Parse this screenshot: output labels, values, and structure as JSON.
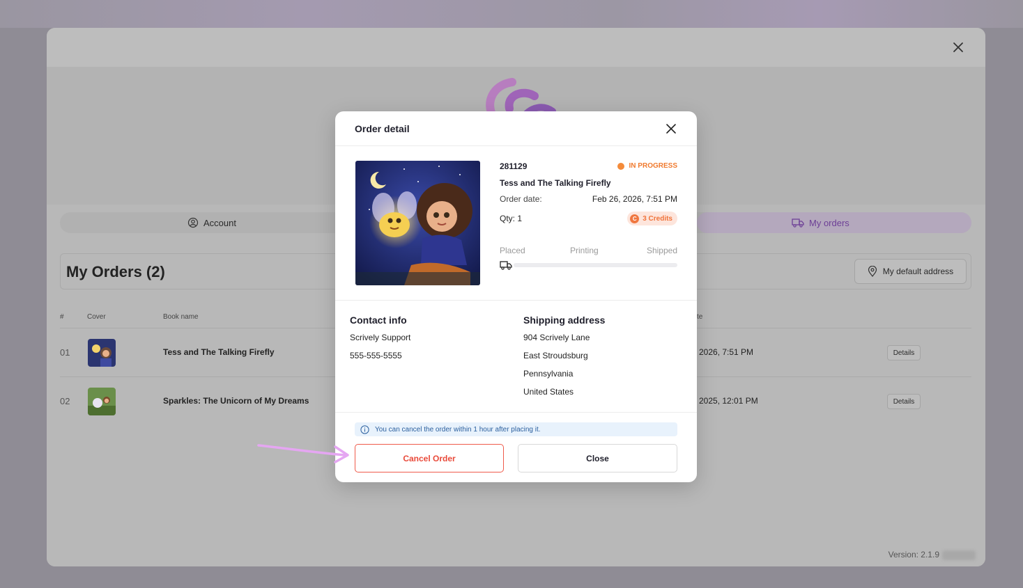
{
  "main": {
    "tabs": [
      {
        "label": "Account",
        "icon": "user-circle-icon"
      },
      {
        "label": "My orders",
        "icon": "truck-icon",
        "active": true
      }
    ],
    "orders_title": "My Orders (2)",
    "default_address_label": "My default address",
    "table": {
      "columns": [
        "#",
        "Cover",
        "Book name",
        "te"
      ],
      "rows": [
        {
          "num": "01",
          "name": "Tess and The Talking Firefly",
          "date": "2026, 7:51 PM",
          "action": "Details"
        },
        {
          "num": "02",
          "name": "Sparkles: The Unicorn of My Dreams",
          "date": "2025, 12:01 PM",
          "action": "Details"
        }
      ]
    },
    "version": "Version: 2.1.9"
  },
  "modal": {
    "title": "Order detail",
    "order_id": "281129",
    "status": "IN PROGRESS",
    "book_title": "Tess and The Talking Firefly",
    "order_date_label": "Order date:",
    "order_date_value": "Feb 26, 2026, 7:51 PM",
    "qty": "Qty: 1",
    "credits": "3 Credits",
    "progress": {
      "steps": [
        "Placed",
        "Printing",
        "Shipped"
      ],
      "current_step": "Placed"
    },
    "contact": {
      "title": "Contact info",
      "name": "Scrively Support",
      "phone": "555-555-5555"
    },
    "shipping": {
      "title": "Shipping address",
      "lines": [
        "904 Scrively Lane",
        "East Stroudsburg",
        "Pennsylvania",
        "United States"
      ]
    },
    "notice": "You can cancel the order within 1 hour after placing it.",
    "cancel_label": "Cancel Order",
    "close_label": "Close"
  },
  "colors": {
    "status": "#f07a2e",
    "cancel": "#e94a3a",
    "accent_purple": "#6d3f96",
    "arrow": "#e5a6f2"
  }
}
